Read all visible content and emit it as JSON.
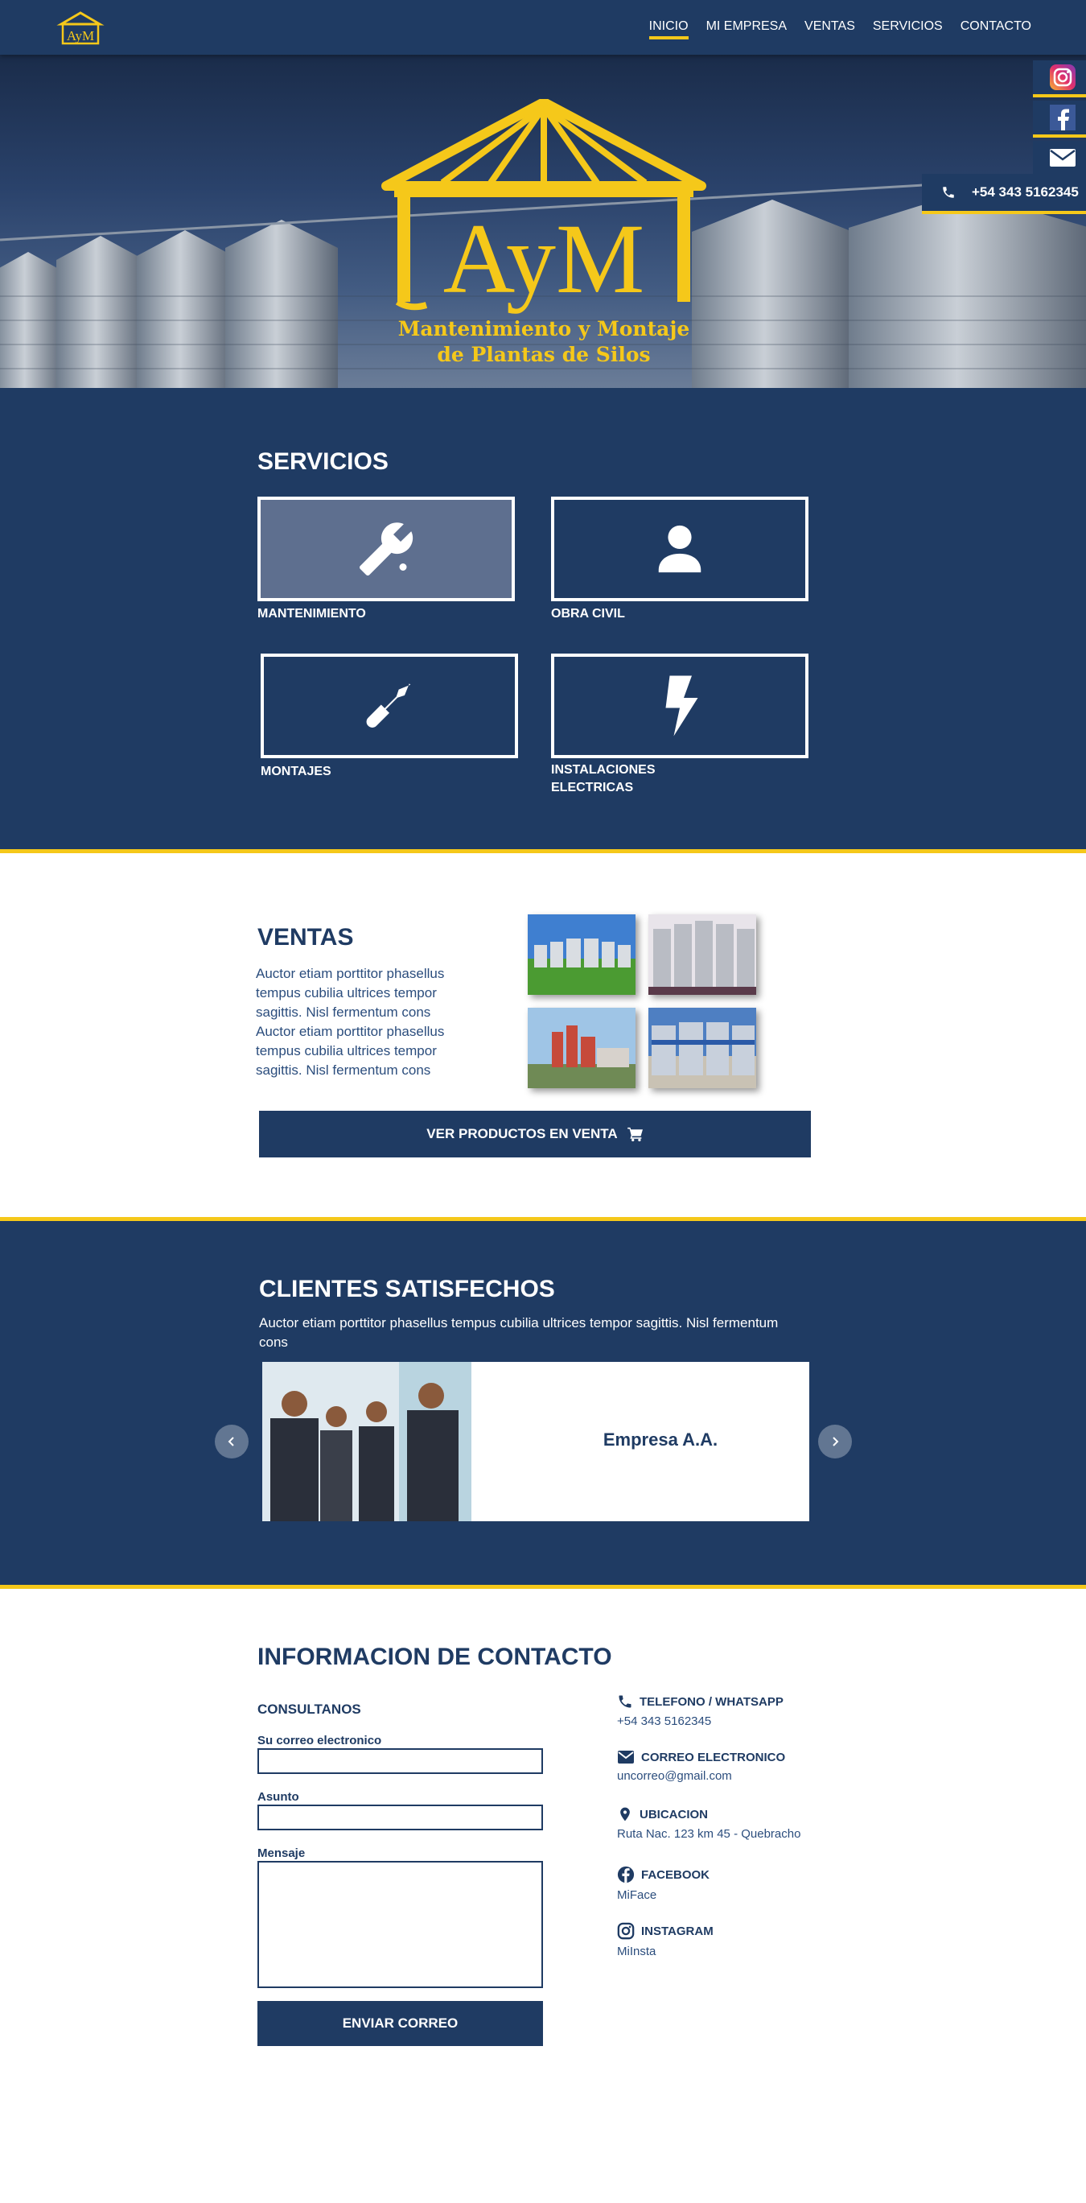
{
  "nav": {
    "logo_text": "AyM",
    "links": [
      "INICIO",
      "MI EMPRESA",
      "VENTAS",
      "SERVICIOS",
      "CONTACTO"
    ],
    "active": "INICIO"
  },
  "hero": {
    "logo_text": "AyM",
    "tagline_1": "Mantenimiento y Montaje",
    "tagline_2": "de Plantas de Silos"
  },
  "side": {
    "icons": [
      "instagram-icon",
      "facebook-icon",
      "mail-icon"
    ],
    "phone": "+54 343 5162345"
  },
  "servicios": {
    "title": "SERVICIOS",
    "items": [
      {
        "label": "MANTENIMIENTO",
        "icon": "wrench-icon"
      },
      {
        "label": "OBRA CIVIL",
        "icon": "user-icon"
      },
      {
        "label": "MONTAJES",
        "icon": "screwdriver-icon"
      },
      {
        "label": "INSTALACIONES ELECTRICAS",
        "icon": "bolt-icon"
      }
    ]
  },
  "ventas": {
    "title": "VENTAS",
    "text": "Auctor etiam porttitor phasellus tempus cubilia ultrices tempor sagittis. Nisl fermentum cons Auctor etiam porttitor phasellus tempus cubilia ultrices tempor sagittis. Nisl fermentum cons",
    "button": "VER PRODUCTOS EN VENTA"
  },
  "clientes": {
    "title": "CLIENTES SATISFECHOS",
    "text": "Auctor etiam porttitor phasellus tempus cubilia ultrices tempor sagittis. Nisl fermentum cons",
    "client_name": "Empresa A.A."
  },
  "contacto": {
    "title": "INFORMACION DE CONTACTO",
    "form_title": "CONSULTANOS",
    "email_label": "Su correo electronico",
    "subject_label": "Asunto",
    "message_label": "Mensaje",
    "send_button": "ENVIAR CORREO",
    "info": [
      {
        "title": "TELEFONO / WHATSAPP",
        "value": "+54 343 5162345",
        "icon": "phone-icon"
      },
      {
        "title": "CORREO ELECTRONICO",
        "value": "uncorreo@gmail.com",
        "icon": "mail-icon"
      },
      {
        "title": "UBICACION",
        "value": "Ruta Nac. 123 km 45 - Quebracho",
        "icon": "location-icon"
      },
      {
        "title": "FACEBOOK",
        "value": "MiFace",
        "icon": "facebook-icon"
      },
      {
        "title": "INSTAGRAM",
        "value": "MiInsta",
        "icon": "instagram-icon"
      }
    ]
  },
  "colors": {
    "primary": "#1f3b63",
    "accent": "#f5c81a",
    "white": "#ffffff"
  }
}
